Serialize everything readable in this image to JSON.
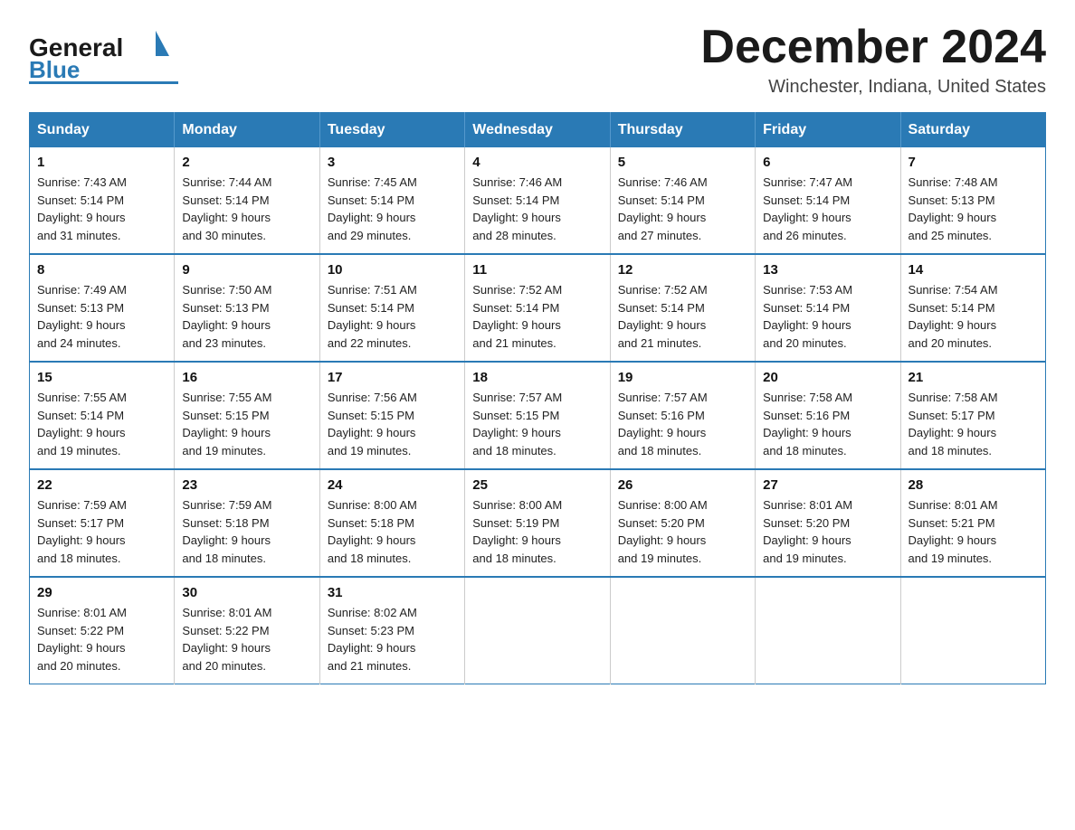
{
  "header": {
    "logo_general": "General",
    "logo_blue": "Blue",
    "month_title": "December 2024",
    "location": "Winchester, Indiana, United States"
  },
  "weekdays": [
    "Sunday",
    "Monday",
    "Tuesday",
    "Wednesday",
    "Thursday",
    "Friday",
    "Saturday"
  ],
  "weeks": [
    [
      {
        "day": "1",
        "sunrise": "7:43 AM",
        "sunset": "5:14 PM",
        "daylight": "9 hours and 31 minutes."
      },
      {
        "day": "2",
        "sunrise": "7:44 AM",
        "sunset": "5:14 PM",
        "daylight": "9 hours and 30 minutes."
      },
      {
        "day": "3",
        "sunrise": "7:45 AM",
        "sunset": "5:14 PM",
        "daylight": "9 hours and 29 minutes."
      },
      {
        "day": "4",
        "sunrise": "7:46 AM",
        "sunset": "5:14 PM",
        "daylight": "9 hours and 28 minutes."
      },
      {
        "day": "5",
        "sunrise": "7:46 AM",
        "sunset": "5:14 PM",
        "daylight": "9 hours and 27 minutes."
      },
      {
        "day": "6",
        "sunrise": "7:47 AM",
        "sunset": "5:14 PM",
        "daylight": "9 hours and 26 minutes."
      },
      {
        "day": "7",
        "sunrise": "7:48 AM",
        "sunset": "5:13 PM",
        "daylight": "9 hours and 25 minutes."
      }
    ],
    [
      {
        "day": "8",
        "sunrise": "7:49 AM",
        "sunset": "5:13 PM",
        "daylight": "9 hours and 24 minutes."
      },
      {
        "day": "9",
        "sunrise": "7:50 AM",
        "sunset": "5:13 PM",
        "daylight": "9 hours and 23 minutes."
      },
      {
        "day": "10",
        "sunrise": "7:51 AM",
        "sunset": "5:14 PM",
        "daylight": "9 hours and 22 minutes."
      },
      {
        "day": "11",
        "sunrise": "7:52 AM",
        "sunset": "5:14 PM",
        "daylight": "9 hours and 21 minutes."
      },
      {
        "day": "12",
        "sunrise": "7:52 AM",
        "sunset": "5:14 PM",
        "daylight": "9 hours and 21 minutes."
      },
      {
        "day": "13",
        "sunrise": "7:53 AM",
        "sunset": "5:14 PM",
        "daylight": "9 hours and 20 minutes."
      },
      {
        "day": "14",
        "sunrise": "7:54 AM",
        "sunset": "5:14 PM",
        "daylight": "9 hours and 20 minutes."
      }
    ],
    [
      {
        "day": "15",
        "sunrise": "7:55 AM",
        "sunset": "5:14 PM",
        "daylight": "9 hours and 19 minutes."
      },
      {
        "day": "16",
        "sunrise": "7:55 AM",
        "sunset": "5:15 PM",
        "daylight": "9 hours and 19 minutes."
      },
      {
        "day": "17",
        "sunrise": "7:56 AM",
        "sunset": "5:15 PM",
        "daylight": "9 hours and 19 minutes."
      },
      {
        "day": "18",
        "sunrise": "7:57 AM",
        "sunset": "5:15 PM",
        "daylight": "9 hours and 18 minutes."
      },
      {
        "day": "19",
        "sunrise": "7:57 AM",
        "sunset": "5:16 PM",
        "daylight": "9 hours and 18 minutes."
      },
      {
        "day": "20",
        "sunrise": "7:58 AM",
        "sunset": "5:16 PM",
        "daylight": "9 hours and 18 minutes."
      },
      {
        "day": "21",
        "sunrise": "7:58 AM",
        "sunset": "5:17 PM",
        "daylight": "9 hours and 18 minutes."
      }
    ],
    [
      {
        "day": "22",
        "sunrise": "7:59 AM",
        "sunset": "5:17 PM",
        "daylight": "9 hours and 18 minutes."
      },
      {
        "day": "23",
        "sunrise": "7:59 AM",
        "sunset": "5:18 PM",
        "daylight": "9 hours and 18 minutes."
      },
      {
        "day": "24",
        "sunrise": "8:00 AM",
        "sunset": "5:18 PM",
        "daylight": "9 hours and 18 minutes."
      },
      {
        "day": "25",
        "sunrise": "8:00 AM",
        "sunset": "5:19 PM",
        "daylight": "9 hours and 18 minutes."
      },
      {
        "day": "26",
        "sunrise": "8:00 AM",
        "sunset": "5:20 PM",
        "daylight": "9 hours and 19 minutes."
      },
      {
        "day": "27",
        "sunrise": "8:01 AM",
        "sunset": "5:20 PM",
        "daylight": "9 hours and 19 minutes."
      },
      {
        "day": "28",
        "sunrise": "8:01 AM",
        "sunset": "5:21 PM",
        "daylight": "9 hours and 19 minutes."
      }
    ],
    [
      {
        "day": "29",
        "sunrise": "8:01 AM",
        "sunset": "5:22 PM",
        "daylight": "9 hours and 20 minutes."
      },
      {
        "day": "30",
        "sunrise": "8:01 AM",
        "sunset": "5:22 PM",
        "daylight": "9 hours and 20 minutes."
      },
      {
        "day": "31",
        "sunrise": "8:02 AM",
        "sunset": "5:23 PM",
        "daylight": "9 hours and 21 minutes."
      },
      null,
      null,
      null,
      null
    ]
  ],
  "labels": {
    "sunrise": "Sunrise:",
    "sunset": "Sunset:",
    "daylight": "Daylight:"
  }
}
